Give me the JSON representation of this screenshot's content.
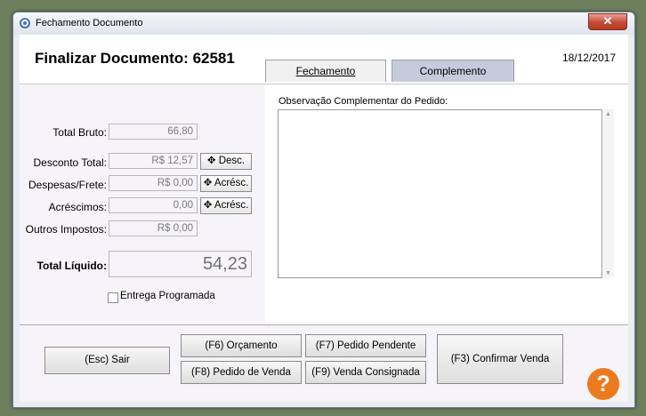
{
  "window": {
    "title": "Fechamento Documento",
    "close_glyph": "✕"
  },
  "header": {
    "title": "Finalizar Documento: 62581",
    "date": "18/12/2017"
  },
  "tabs": [
    {
      "label": "Fechamento",
      "active": true
    },
    {
      "label": "Complemento",
      "active": false
    }
  ],
  "totals": {
    "total_bruto": {
      "label": "Total Bruto:",
      "value": "66,80"
    },
    "desconto": {
      "label": "Desconto Total:",
      "value": "R$ 12,57",
      "button": "Desc."
    },
    "despesas": {
      "label": "Despesas/Frete:",
      "value": "R$ 0,00",
      "button": "Acrésc."
    },
    "acrescimos": {
      "label": "Acréscimos:",
      "value": "0,00",
      "button": "Acrésc."
    },
    "outros": {
      "label": "Outros Impostos:",
      "value": "R$ 0,00"
    },
    "liquido": {
      "label": "Total Líquido:",
      "value": "54,23"
    },
    "entrega": {
      "label": "Entrega Programada",
      "checked": false
    }
  },
  "obs": {
    "label": "Observação Complementar do Pedido:",
    "value": ""
  },
  "footer": {
    "sair": "(Esc) Sair",
    "orcamento": "(F6) Orçamento",
    "pendente": "(F7) Pedido Pendente",
    "pedido_venda": "(F8) Pedido de Venda",
    "consignada": "(F9) Venda Consignada",
    "confirmar": "(F3) Confirmar Venda",
    "help": "?"
  },
  "icons": {
    "plus": "plus-icon",
    "help": "help-icon",
    "app": "app-icon",
    "close": "close-icon"
  },
  "colors": {
    "tab_inactive": "#c5cbdd",
    "help": "#ec7b1f",
    "close": "#c44a34"
  }
}
